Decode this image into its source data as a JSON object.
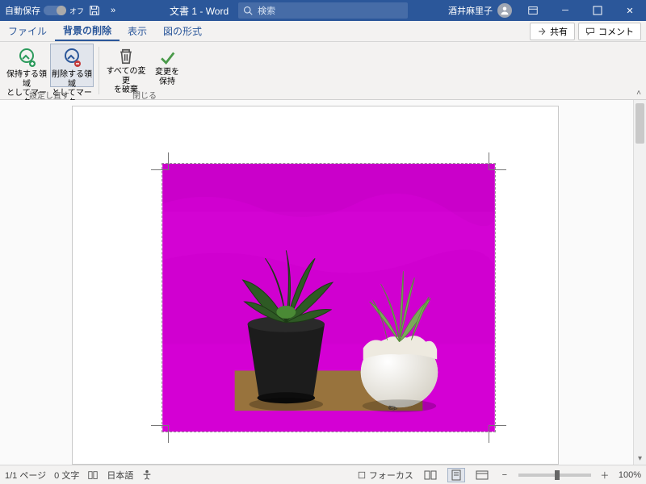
{
  "titlebar": {
    "autosave_label": "自動保存",
    "autosave_state": "オフ",
    "doc_title": "文書 1  -  Word",
    "search_placeholder": "検索",
    "user_name": "酒井麻里子"
  },
  "tabs": {
    "file": "ファイル",
    "bg_removal": "背景の削除",
    "view": "表示",
    "pic_format": "図の形式"
  },
  "right_actions": {
    "share": "共有",
    "comment": "コメント"
  },
  "ribbon": {
    "mark_keep": {
      "line1": "保持する領域",
      "line2": "としてマーク"
    },
    "mark_remove": {
      "line1": "削除する領域",
      "line2": "としてマーク"
    },
    "group_refine": "設定し直す",
    "discard_all": {
      "line1": "すべての変更",
      "line2": "を破棄"
    },
    "keep_changes": {
      "line1": "変更を",
      "line2": "保持"
    },
    "group_close": "閉じる"
  },
  "status": {
    "page": "1/1 ページ",
    "words": "0 文字",
    "lang": "日本語",
    "focus": "フォーカス",
    "zoom": "100%"
  },
  "colors": {
    "accent": "#2b579a",
    "magenta": "#d400d4"
  }
}
